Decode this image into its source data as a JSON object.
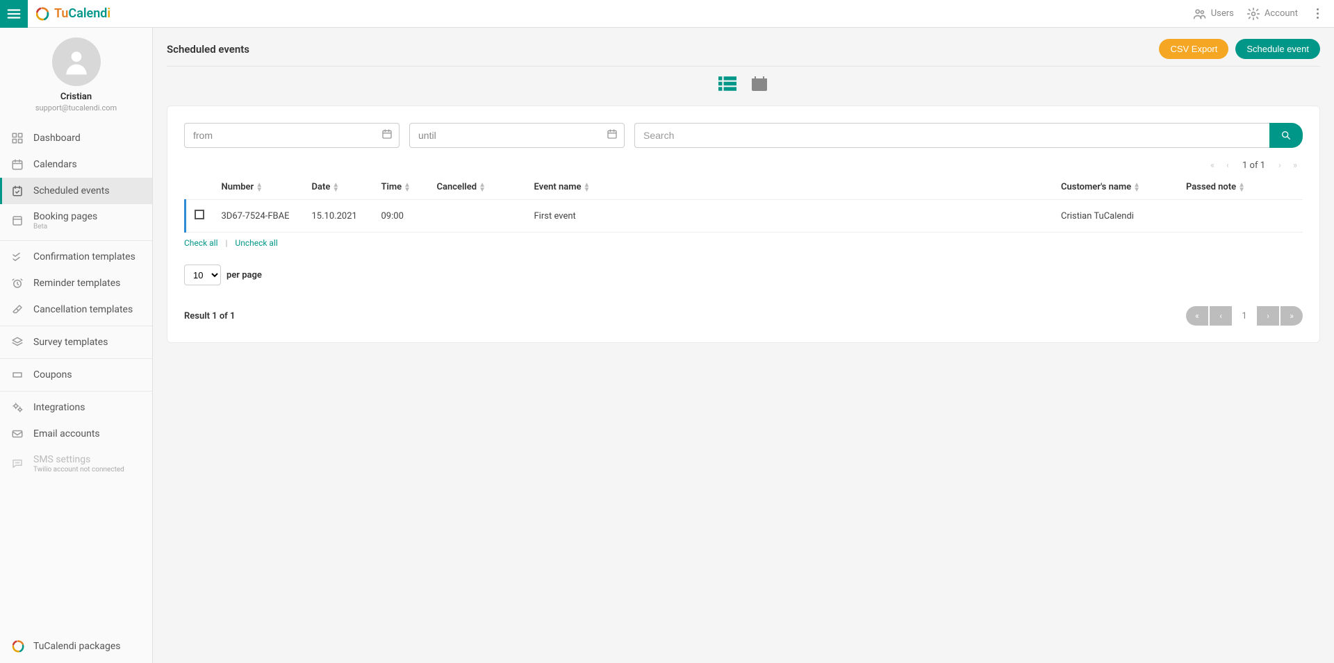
{
  "brand": {
    "part1": "Tu",
    "part2": "Calend",
    "part3": "i"
  },
  "topbar": {
    "users_label": "Users",
    "account_label": "Account"
  },
  "profile": {
    "name": "Cristian",
    "email": "support@tucalendi.com"
  },
  "sidebar": {
    "items": [
      {
        "id": "dashboard",
        "label": "Dashboard"
      },
      {
        "id": "calendars",
        "label": "Calendars"
      },
      {
        "id": "scheduled-events",
        "label": "Scheduled events"
      },
      {
        "id": "booking-pages",
        "label": "Booking pages",
        "sub": "Beta"
      },
      {
        "id": "confirmation-templates",
        "label": "Confirmation templates"
      },
      {
        "id": "reminder-templates",
        "label": "Reminder templates"
      },
      {
        "id": "cancellation-templates",
        "label": "Cancellation templates"
      },
      {
        "id": "survey-templates",
        "label": "Survey templates"
      },
      {
        "id": "coupons",
        "label": "Coupons"
      },
      {
        "id": "integrations",
        "label": "Integrations"
      },
      {
        "id": "email-accounts",
        "label": "Email accounts"
      },
      {
        "id": "sms-settings",
        "label": "SMS settings",
        "sub": "Twilio account not connected"
      }
    ],
    "footer": "TuCalendi packages"
  },
  "page": {
    "title": "Scheduled events",
    "csv_export": "CSV Export",
    "schedule_event": "Schedule event"
  },
  "filters": {
    "from_placeholder": "from",
    "until_placeholder": "until",
    "search_placeholder": "Search"
  },
  "pagination": {
    "top_label": "1 of 1",
    "result_text": "Result 1 of 1",
    "per_page_value": "10",
    "per_page_label": "per page",
    "current_page": "1"
  },
  "table": {
    "headers": {
      "number": "Number",
      "date": "Date",
      "time": "Time",
      "cancelled": "Cancelled",
      "event_name": "Event name",
      "customer_name": "Customer's name",
      "passed_note": "Passed note"
    },
    "rows": [
      {
        "number": "3D67-7524-FBAE",
        "date": "15.10.2021",
        "time": "09:00",
        "cancelled": "",
        "event_name": "First event",
        "customer_name": "Cristian TuCalendi",
        "passed_note": ""
      }
    ]
  },
  "bulk": {
    "check_all": "Check all",
    "uncheck_all": "Uncheck all"
  }
}
